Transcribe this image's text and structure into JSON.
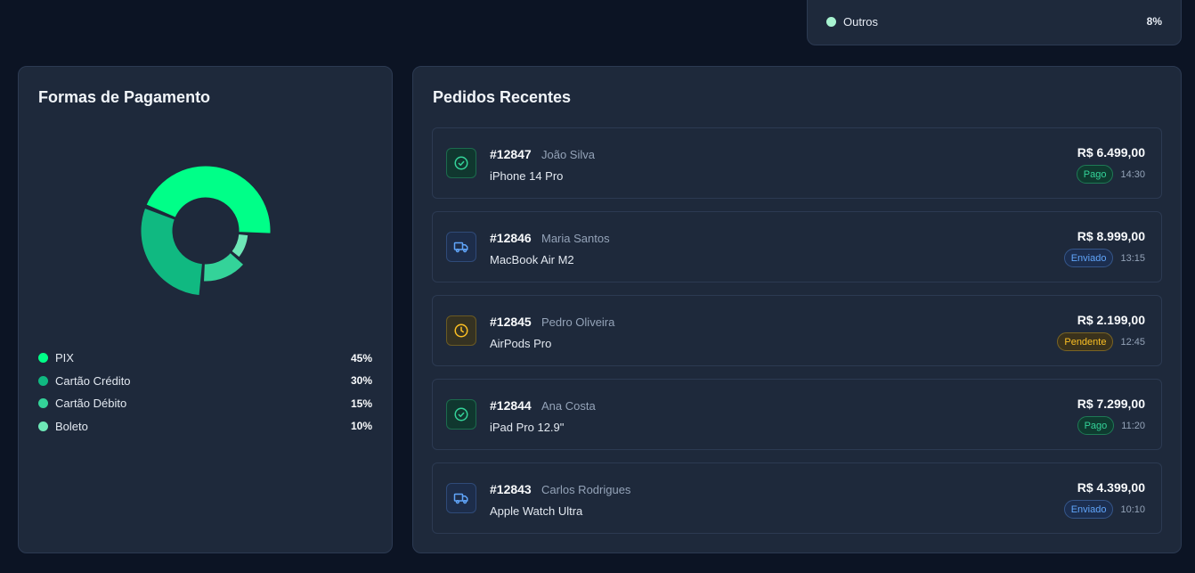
{
  "top_partial": {
    "legend_item": {
      "label": "Outros",
      "pct": "8%",
      "color": "#a7f3d0"
    },
    "partial_dot_color": "#34d399"
  },
  "payment": {
    "title": "Formas de Pagamento",
    "chart_data": {
      "type": "pie",
      "categories": [
        "PIX",
        "Cartão Crédito",
        "Cartão Débito",
        "Boleto"
      ],
      "values": [
        45,
        30,
        15,
        10
      ],
      "colors": [
        "#00ff88",
        "#10b981",
        "#34d399",
        "#6ee7b7"
      ],
      "hole": "donut",
      "legend_placement": "bottom"
    },
    "legend": [
      {
        "label": "PIX",
        "pct": "45%",
        "color": "#00ff88"
      },
      {
        "label": "Cartão Crédito",
        "pct": "30%",
        "color": "#10b981"
      },
      {
        "label": "Cartão Débito",
        "pct": "15%",
        "color": "#34d399"
      },
      {
        "label": "Boleto",
        "pct": "10%",
        "color": "#6ee7b7"
      }
    ]
  },
  "orders": {
    "title": "Pedidos Recentes",
    "items": [
      {
        "id": "#12847",
        "customer": "João Silva",
        "product": "iPhone 14 Pro",
        "price": "R$ 6.499,00",
        "status": "Pago",
        "status_key": "pago",
        "icon": "check-circle-icon",
        "time": "14:30"
      },
      {
        "id": "#12846",
        "customer": "Maria Santos",
        "product": "MacBook Air M2",
        "price": "R$ 8.999,00",
        "status": "Enviado",
        "status_key": "enviado",
        "icon": "truck-icon",
        "time": "13:15"
      },
      {
        "id": "#12845",
        "customer": "Pedro Oliveira",
        "product": "AirPods Pro",
        "price": "R$ 2.199,00",
        "status": "Pendente",
        "status_key": "pendente",
        "icon": "clock-icon",
        "time": "12:45"
      },
      {
        "id": "#12844",
        "customer": "Ana Costa",
        "product": "iPad Pro 12.9\"",
        "price": "R$ 7.299,00",
        "status": "Pago",
        "status_key": "pago",
        "icon": "check-circle-icon",
        "time": "11:20"
      },
      {
        "id": "#12843",
        "customer": "Carlos Rodrigues",
        "product": "Apple Watch Ultra",
        "price": "R$ 4.399,00",
        "status": "Enviado",
        "status_key": "enviado",
        "icon": "truck-icon",
        "time": "10:10"
      }
    ]
  }
}
